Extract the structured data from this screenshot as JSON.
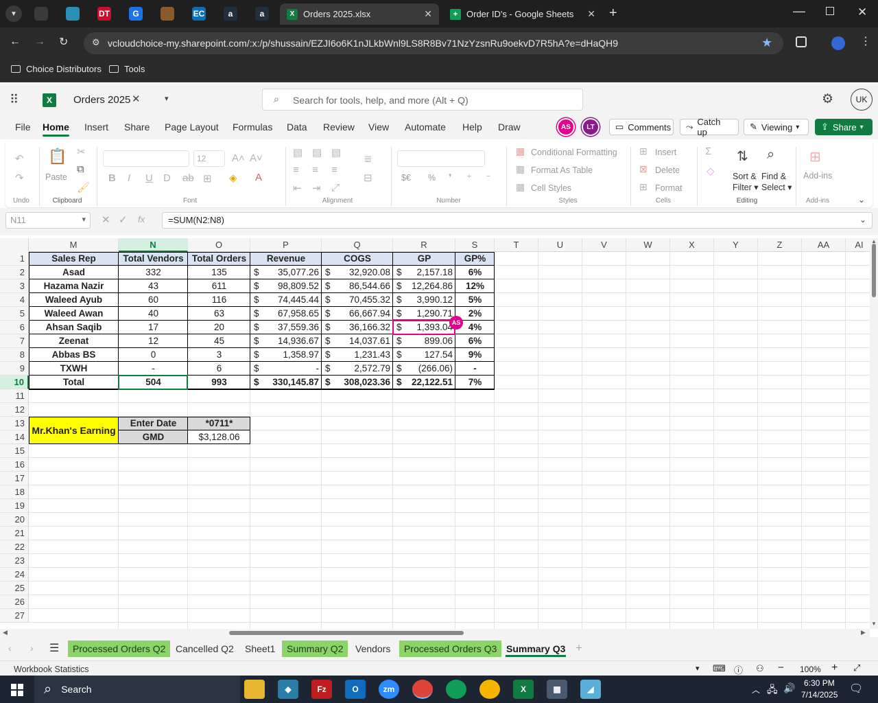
{
  "browser": {
    "pinned_tabs": [
      {
        "icon": "openai-icon",
        "color": "#3a3a3a"
      },
      {
        "icon": "app-icon",
        "color": "#2a8fb5"
      },
      {
        "icon": "dollar-tree-icon",
        "color": "#c8102e",
        "label": "DT"
      },
      {
        "icon": "google-g-icon",
        "color": "#1a73e8",
        "label": "G"
      },
      {
        "icon": "package-icon",
        "color": "#8a5a2b"
      },
      {
        "icon": "ec-icon",
        "color": "#0a6fb8",
        "label": "EC"
      },
      {
        "icon": "amazon-icon",
        "color": "#232f3e",
        "label": "a"
      },
      {
        "icon": "amazon-icon",
        "color": "#232f3e",
        "label": "a"
      }
    ],
    "tabs": [
      {
        "title": "Orders 2025.xlsx",
        "active": true
      },
      {
        "title": "Order ID's - Google Sheets",
        "active": false
      }
    ],
    "url": "vcloudchoice-my.sharepoint.com/:x:/p/shussain/EZJI6o6K1nJLkbWnl9LS8R8Bv71NzYzsnRu9oekvD7R5hA?e=dHaQH9",
    "bookmarks": [
      "Choice Distributors",
      "Tools"
    ]
  },
  "app": {
    "doc_title": "Orders 2025",
    "search_placeholder": "Search for tools, help, and more (Alt + Q)",
    "user_initials": "UK",
    "menus": [
      "File",
      "Home",
      "Insert",
      "Share",
      "Page Layout",
      "Formulas",
      "Data",
      "Review",
      "View",
      "Automate",
      "Help",
      "Draw"
    ],
    "active_menu": "Home",
    "collaborators": [
      {
        "initials": "AS",
        "color": "#e3008c"
      },
      {
        "initials": "LT",
        "color": "#8a1a8a"
      }
    ],
    "buttons": {
      "comments": "Comments",
      "catchup": "Catch up",
      "viewing": "Viewing",
      "share": "Share"
    }
  },
  "ribbon": {
    "groups": {
      "undo": "Undo",
      "clipboard": "Clipboard",
      "font": "Font",
      "alignment": "Alignment",
      "number": "Number",
      "styles": "Styles",
      "cells": "Cells",
      "editing": "Editing",
      "addins": "Add-ins"
    },
    "paste": "Paste",
    "font_size": "12",
    "conditional_formatting": "Conditional Formatting",
    "format_as_table": "Format As Table",
    "cell_styles": "Cell Styles",
    "insert": "Insert",
    "delete": "Delete",
    "format": "Format",
    "sort_filter_1": "Sort &",
    "sort_filter_2": "Filter",
    "find_select_1": "Find &",
    "find_select_2": "Select",
    "addins": "Add-ins",
    "currency_symbol": "$€",
    "percent_symbol": "%"
  },
  "formula_bar": {
    "name_box": "N11",
    "formula": "=SUM(N2:N8)"
  },
  "grid": {
    "columns": [
      "M",
      "N",
      "O",
      "P",
      "Q",
      "R",
      "S",
      "T",
      "U",
      "V",
      "W",
      "X",
      "Y",
      "Z",
      "AA",
      "AI"
    ],
    "rows": [
      "1",
      "2",
      "3",
      "4",
      "5",
      "6",
      "7",
      "8",
      "9",
      "10",
      "11",
      "12",
      "13",
      "14",
      "15",
      "16",
      "17",
      "18",
      "19",
      "20",
      "21",
      "22",
      "23",
      "24",
      "25",
      "26",
      "27"
    ],
    "headers": [
      "Sales Rep",
      "Total Vendors",
      "Total Orders",
      "Revenue",
      "COGS",
      "GP",
      "GP%"
    ],
    "data": [
      [
        "Asad",
        "332",
        "135",
        "35,077.26",
        "32,920.08",
        "2,157.18",
        "6%"
      ],
      [
        "Hazama Nazir",
        "43",
        "611",
        "98,809.52",
        "86,544.66",
        "12,264.86",
        "12%"
      ],
      [
        "Waleed Ayub",
        "60",
        "116",
        "74,445.44",
        "70,455.32",
        "3,990.12",
        "5%"
      ],
      [
        "Waleed Awan",
        "40",
        "63",
        "67,958.65",
        "66,667.94",
        "1,290.71",
        "2%"
      ],
      [
        "Ahsan Saqib",
        "17",
        "20",
        "37,559.36",
        "36,166.32",
        "1,393.04",
        "4%"
      ],
      [
        "Zeenat",
        "12",
        "45",
        "14,936.67",
        "14,037.61",
        "899.06",
        "6%"
      ],
      [
        "Abbas BS",
        "0",
        "3",
        "1,358.97",
        "1,231.43",
        "127.54",
        "9%"
      ],
      [
        "TXWH",
        "-",
        "6",
        "-",
        "2,572.79",
        "(266.06)",
        "-"
      ],
      [
        "Total",
        "504",
        "993",
        "330,145.87",
        "308,023.36",
        "22,122.51",
        "7%"
      ]
    ],
    "currency": "$",
    "earning_label": "Mr.Khan's Earning",
    "enter_date_label": "Enter Date",
    "enter_date_value": "*0711*",
    "gmd_label": "GMD",
    "gmd_value": "$3,128.06",
    "presence_badge": "AS"
  },
  "sheets": [
    {
      "name": "Processed Orders Q2",
      "green": true
    },
    {
      "name": "Cancelled Q2",
      "green": false
    },
    {
      "name": "Sheet1",
      "green": false
    },
    {
      "name": "Summary Q2",
      "green": true
    },
    {
      "name": "Vendors",
      "green": false
    },
    {
      "name": "Processed Orders Q3",
      "green": true
    },
    {
      "name": "Summary Q3",
      "green": false,
      "active": true
    }
  ],
  "status": {
    "left": "Workbook Statistics",
    "zoom": "100%"
  },
  "taskbar": {
    "search": "Search",
    "time": "6:30 PM",
    "date": "7/14/2025"
  },
  "colors": {
    "excel_green": "#107c41",
    "yellow_fill": "#ffff00",
    "header_fill": "#dae3f3",
    "label_fill": "#d9d9d9",
    "presence": "#e3008c"
  }
}
